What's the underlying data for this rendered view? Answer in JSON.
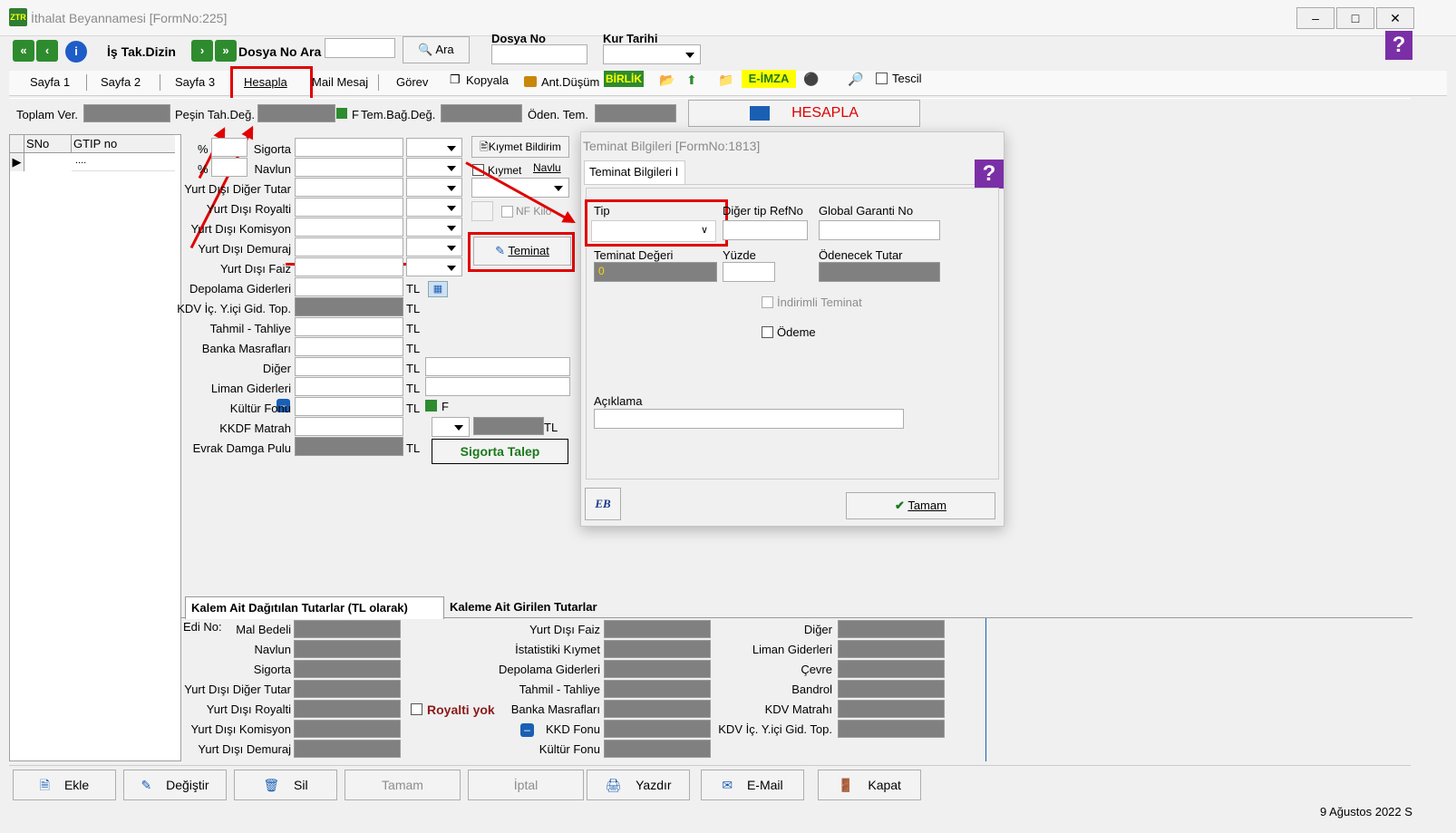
{
  "window": {
    "title": "İthalat Beyannamesi [FormNo:225]",
    "app_icon": "ZTR",
    "controls": [
      "minimize",
      "maximize",
      "close"
    ]
  },
  "toolbar": {
    "is_tak": "İş Tak.Dizin",
    "dosya_no_ara": "Dosya No Ara",
    "ara": "Ara",
    "dosya_no": "Dosya No",
    "kur_tarihi": "Kur Tarihi"
  },
  "tabs": [
    "Sayfa 1",
    "Sayfa 2",
    "Sayfa 3",
    "Hesapla",
    "Mail Mesaj",
    "Görev",
    "Kopyala",
    "Ant.Düşüm",
    "BİRLİK",
    "E-İMZA",
    "Tescil"
  ],
  "summary": {
    "toplam_ver": "Toplam Ver.",
    "pesin": "Peşin Tah.Değ.",
    "f": "F",
    "tem_bag": "Tem.Bağ.Değ.",
    "oden_tem": "Öden. Tem.",
    "hesapla": "HESAPLA"
  },
  "grid": {
    "headers": [
      "SNo",
      "GTIP no"
    ],
    "row_value": "...."
  },
  "pct": "%",
  "fields": [
    "Sigorta",
    "Navlun",
    "Yurt Dışı Diğer Tutar",
    "Yurt Dışı Royalti",
    "Yurt Dışı Komisyon",
    "Yurt Dışı Demuraj",
    "Yurt Dışı Faiz",
    "Depolama Giderleri",
    "KDV İç. Y.içi Gid. Top.",
    "Tahmil - Tahliye",
    "Banka Masrafları",
    "Diğer",
    "Liman Giderleri",
    "Kültür Fonu",
    "KKDF Matrah",
    "Evrak Damga Pulu"
  ],
  "unit": "TL",
  "side": {
    "kiymet_bildirim": "Kıymet Bildirim",
    "kiymet": "Kıymet",
    "navlu": "Navlu",
    "nf_kilo": "NF Kilo",
    "teminat": "Teminat",
    "sigorta_talep": "Sigorta Talep",
    "f": "F"
  },
  "dialog": {
    "title": "Teminat Bilgileri [FormNo:1813]",
    "tab": "Teminat Bilgileri I",
    "tip": "Tip",
    "diger_tip": "Diğer tip RefNo",
    "global": "Global Garanti No",
    "teminat_degeri": "Teminat Değeri",
    "teminat_value": "0",
    "yuzde": "Yüzde",
    "odenecek": "Ödenecek Tutar",
    "indirimli": "İndirimli Teminat",
    "odeme": "Ödeme",
    "aciklama": "Açıklama",
    "tamam": "Tamam",
    "eb": "EB"
  },
  "bottom_tabs": [
    "Kalem Ait Dağıtılan Tutarlar (TL olarak)",
    "Kaleme Ait Girilen Tutarlar"
  ],
  "edi_no": "Edi No:",
  "col1": [
    "Mal Bedeli",
    "Navlun",
    "Sigorta",
    "Yurt Dışı Diğer Tutar",
    "Yurt Dışı Royalti",
    "Yurt Dışı Komisyon",
    "Yurt Dışı Demuraj"
  ],
  "royalti_yok": "Royalti yok",
  "col2": [
    "Yurt Dışı Faiz",
    "İstatistiki Kıymet",
    "Depolama Giderleri",
    "Tahmil - Tahliye",
    "Banka Masrafları",
    "KKD Fonu",
    "Kültür Fonu"
  ],
  "col3": [
    "Diğer",
    "Liman Giderleri",
    "Çevre",
    "Bandrol",
    "KDV Matrahı",
    "KDV İç. Y.içi Gid. Top."
  ],
  "buttons": [
    "Ekle",
    "Değiştir",
    "Sil",
    "Tamam",
    "İptal",
    "Yazdır",
    "E-Mail",
    "Kapat"
  ],
  "status_date": "9 Ağustos 2022 S"
}
